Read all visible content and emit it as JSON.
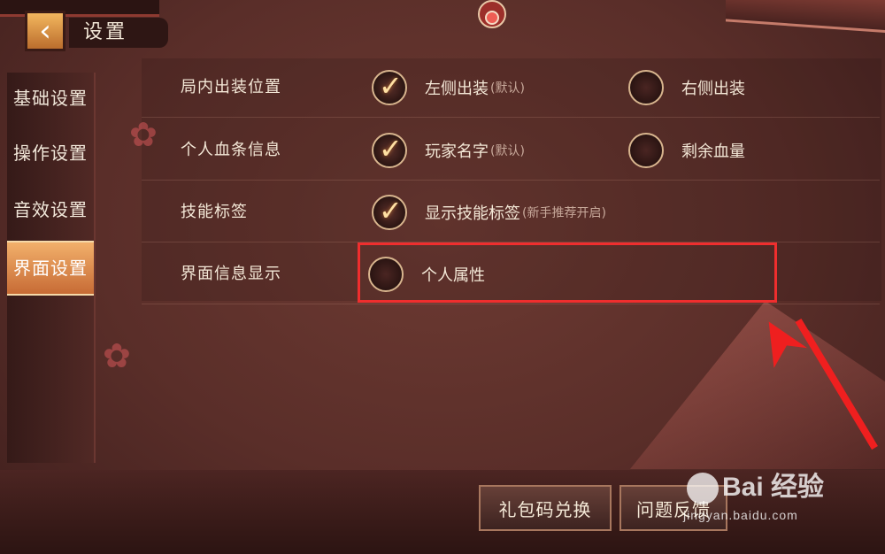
{
  "window": {
    "title": "设置"
  },
  "header": {
    "back_icon": "chevron-left-icon"
  },
  "sidebar": {
    "items": [
      {
        "label": "基础设置",
        "active": false
      },
      {
        "label": "操作设置",
        "active": false
      },
      {
        "label": "音效设置",
        "active": false
      },
      {
        "label": "界面设置",
        "active": true
      }
    ]
  },
  "settings": {
    "rows": [
      {
        "label": "局内出装位置",
        "options": [
          {
            "text": "左侧出装",
            "note": "(默认)",
            "checked": true
          },
          {
            "text": "右侧出装",
            "note": "",
            "checked": false
          }
        ]
      },
      {
        "label": "个人血条信息",
        "options": [
          {
            "text": "玩家名字",
            "note": "(默认)",
            "checked": true
          },
          {
            "text": "剩余血量",
            "note": "",
            "checked": false
          }
        ]
      },
      {
        "label": "技能标签",
        "options": [
          {
            "text": "显示技能标签",
            "note": "(新手推荐开启)",
            "checked": true
          }
        ]
      },
      {
        "label": "界面信息显示",
        "options": [
          {
            "text": "个人属性",
            "note": "",
            "checked": false
          }
        ]
      }
    ]
  },
  "footer": {
    "gift_code_button": "礼包码兑换",
    "feedback_button": "问题反馈"
  },
  "watermark": {
    "main": "Bai 经验",
    "sub": "jingyan.baidu.com"
  },
  "colors": {
    "highlight": "#ef2e2e",
    "active_tab": "#e49a52"
  }
}
